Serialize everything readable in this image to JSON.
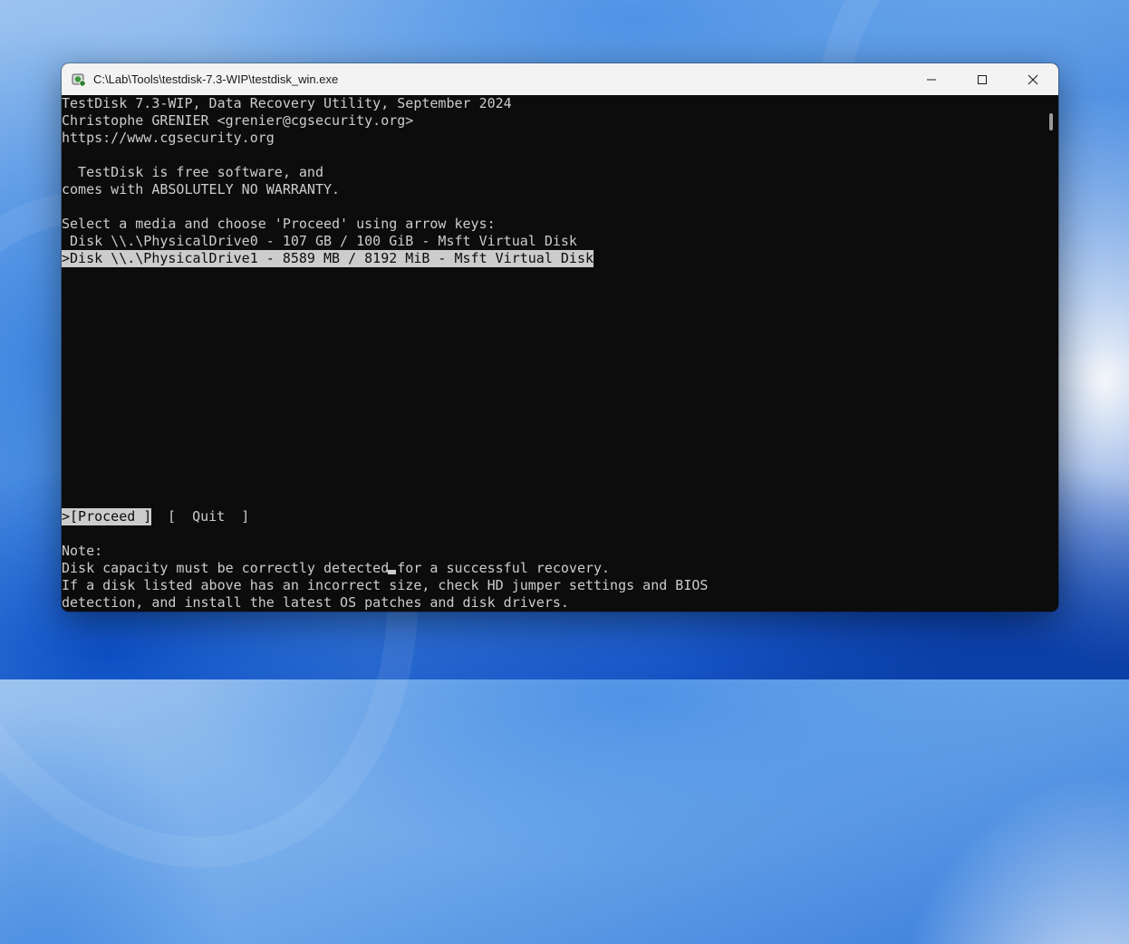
{
  "window": {
    "title": "C:\\Lab\\Tools\\testdisk-7.3-WIP\\testdisk_win.exe",
    "icon": "testdisk-app-icon",
    "controls": [
      "minimize-icon",
      "maximize-icon",
      "close-icon"
    ]
  },
  "console": {
    "header": [
      "TestDisk 7.3-WIP, Data Recovery Utility, September 2024",
      "Christophe GRENIER <grenier@cgsecurity.org>",
      "https://www.cgsecurity.org"
    ],
    "license": [
      "  TestDisk is free software, and",
      "comes with ABSOLUTELY NO WARRANTY."
    ],
    "prompt": "Select a media and choose 'Proceed' using arrow keys:",
    "disks": [
      " Disk \\\\.\\PhysicalDrive0 - 107 GB / 100 GiB - Msft Virtual Disk",
      ">Disk \\\\.\\PhysicalDrive1 - 8589 MB / 8192 MiB - Msft Virtual Disk"
    ],
    "selected_disk_index": 1,
    "actions": {
      "proceed": ">[Proceed ]",
      "quit": "[  Quit  ]"
    },
    "note": [
      "Note:",
      "Disk capacity must be correctly detected for a successful recovery.",
      "If a disk listed above has an incorrect size, check HD jumper settings and BIOS",
      "detection, and install the latest OS patches and disk drivers."
    ]
  },
  "colors": {
    "console_bg": "#0c0c0c",
    "console_fg": "#cccccc",
    "highlight_bg": "#cccccc",
    "titlebar_bg": "#f3f3f3"
  }
}
